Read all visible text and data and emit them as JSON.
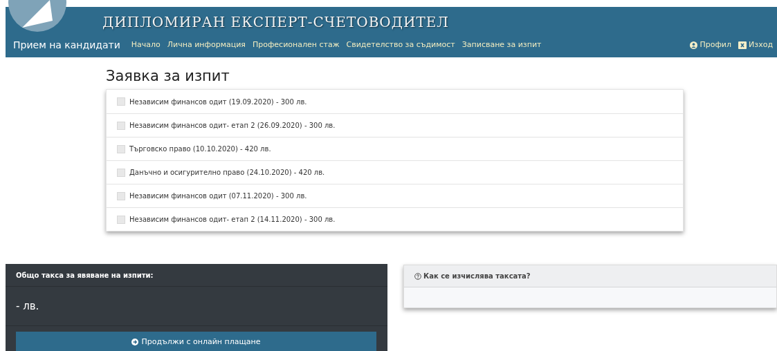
{
  "header": {
    "title": "ДИПЛОМИРАН ЕКСПЕРТ-СЧЕТОВОДИТЕЛ",
    "brand": "Прием на кандидати",
    "nav": [
      {
        "label": "Начало"
      },
      {
        "label": "Лична информация"
      },
      {
        "label": "Професионален стаж"
      },
      {
        "label": "Свидетелство за съдимост"
      },
      {
        "label": "Записване за изпит"
      }
    ],
    "user_links": [
      {
        "kind": "profile",
        "label": "Профил"
      },
      {
        "kind": "logout",
        "label": "Изход"
      }
    ]
  },
  "exam_request": {
    "heading": "Заявка за изпит",
    "options": [
      {
        "label": "Независим финансов одит (19.09.2020) - 300 лв.",
        "checked": false
      },
      {
        "label": "Независим финансов одит- етап 2 (26.09.2020) - 300 лв.",
        "checked": false
      },
      {
        "label": "Търговско право (10.10.2020) - 420 лв.",
        "checked": false
      },
      {
        "label": "Данъчно и осигурително право (24.10.2020) - 420 лв.",
        "checked": false
      },
      {
        "label": "Независим финансов одит (07.11.2020) - 300 лв.",
        "checked": false
      },
      {
        "label": "Независим финансов одит- етап 2 (14.11.2020) - 300 лв.",
        "checked": false
      }
    ]
  },
  "fee_panel": {
    "title": "Общо такса за явяване на изпити:",
    "amount": "- лв.",
    "button": "Продължи с онлайн плащане"
  },
  "help_panel": {
    "title": "Как се изчислява таксата?"
  }
}
